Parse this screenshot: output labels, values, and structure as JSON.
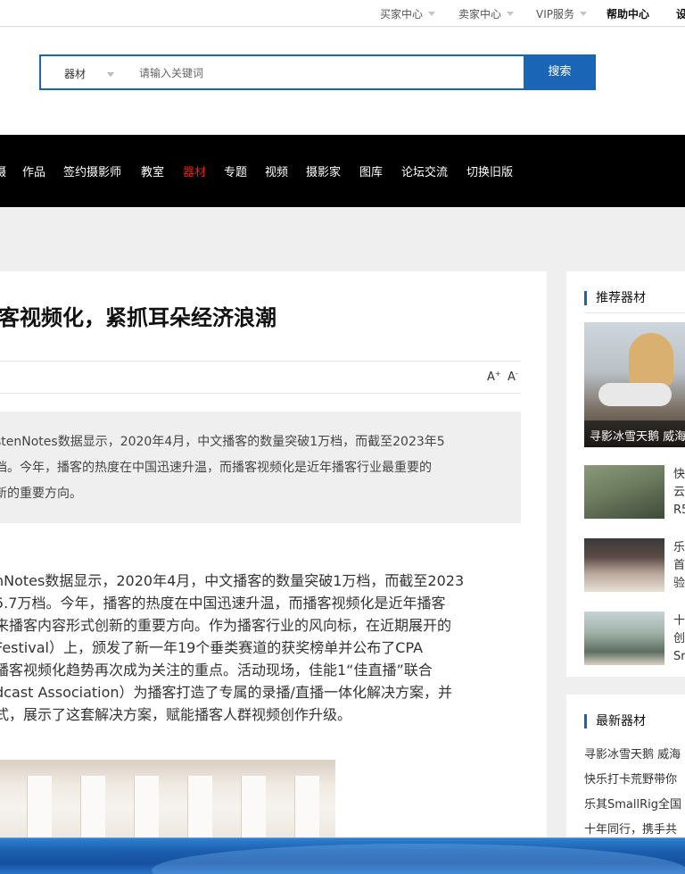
{
  "topbar": {
    "items": [
      {
        "label": "买家中心",
        "dropdown": true
      },
      {
        "label": "卖家中心",
        "dropdown": true
      },
      {
        "label": "VIP服务",
        "dropdown": true
      },
      {
        "label": "帮助中心",
        "dropdown": false
      },
      {
        "label": "设",
        "dropdown": false
      }
    ]
  },
  "search": {
    "category": "器材",
    "placeholder": "请输入关键词",
    "button_label": "搜索"
  },
  "nav": {
    "items": [
      "摄",
      "作品",
      "签约摄影师",
      "教室",
      "器材",
      "专题",
      "视频",
      "摄影家",
      "图库",
      "论坛交流",
      "切换旧版"
    ],
    "active": "器材"
  },
  "article": {
    "title": "客视频化，紧抓耳朵经济浪潮",
    "font_increase": "A",
    "font_decrease": "A",
    "summary_lines": [
      "stenNotes数据显示，2020年4月，中文播客的数量突破1万档，而截至2023年5",
      "档。今年，播客的热度在中国迅速升温，而播客视频化是近年播客行业最重要的",
      "新的重要方向。"
    ],
    "body_lines": [
      "nNotes数据显示，2020年4月，中文播客的数量突破1万档，而截至2023",
      "5.7万档。今年，播客的热度在中国迅速升温，而播客视频化是近年播客",
      "来播客内容形式创新的重要方向。作为播客行业的风向标，在近期展开的",
      "Festival）上，颁发了新一年19个垂类赛道的获奖榜单并公布了CPA",
      "播客视频化趋势再次成为关注的重点。活动现场，佳能1“佳直播”联合",
      "dcast Association）为播客打造了专属的录播/直播一体化解决方案，并",
      "式，展示了这套解决方案，赋能播客人群视频创作升级。"
    ]
  },
  "recommended": {
    "heading": "推荐器材",
    "featured_caption": "寻影冰雪天鹅 威海",
    "items": [
      {
        "lines": [
          "快",
          "云",
          "R5"
        ]
      },
      {
        "lines": [
          "乐",
          "首",
          "验"
        ]
      },
      {
        "lines": [
          "十",
          "创",
          "Sr"
        ]
      }
    ]
  },
  "latest": {
    "heading": "最新器材",
    "items": [
      "寻影冰雪天鹅 威海",
      "快乐打卡荒野带你",
      "乐其SmallRig全国",
      "十年同行，携手共"
    ]
  }
}
